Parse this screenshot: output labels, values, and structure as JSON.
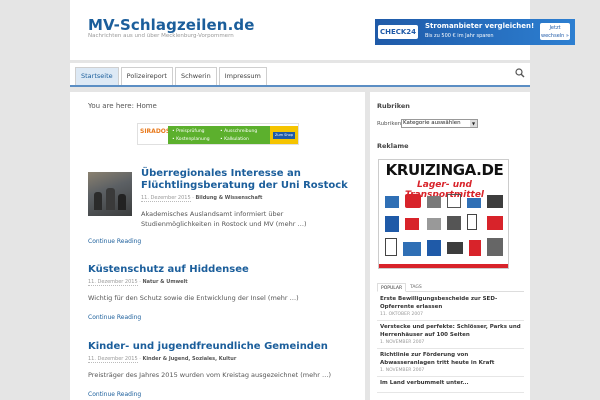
{
  "site": {
    "title": "MV-Schlagzeilen.de",
    "description": "Nachrichten aus und über Mecklenburg-Vorpommern"
  },
  "header_ad": {
    "brand": "CHECK24",
    "headline": "Stromanbieter vergleichen!",
    "subline": "Bis zu 500 € im Jahr sparen",
    "button": "Jetzt wechseln »"
  },
  "nav": {
    "items": [
      {
        "label": "Startseite",
        "active": true
      },
      {
        "label": "Polizeireport",
        "active": false
      },
      {
        "label": "Schwerin",
        "active": false
      },
      {
        "label": "Impressum",
        "active": false
      }
    ],
    "search_icon": "search-icon"
  },
  "main": {
    "breadcrumb": "You are here: Home",
    "mid_ad": {
      "brand": "SIRADOS",
      "features": [
        "• Preisprüfung",
        "• Ausschreibung",
        "• Kostenplanung",
        "• Kalkulation"
      ],
      "button": "Zum Shop"
    },
    "posts": [
      {
        "title": "Überregionales Interesse an Flüchtlingsberatung der Uni Rostock",
        "date": "11. Dezember 2015",
        "categories": "Bildung & Wissenschaft",
        "excerpt": "Akademisches Auslandsamt informiert über Studienmöglichkeiten in Rostock und MV (mehr …)",
        "continue": "Continue Reading"
      },
      {
        "title": "Küstenschutz auf Hiddensee",
        "date": "11. Dezember 2015",
        "categories": "Natur & Umwelt",
        "excerpt": "Wichtig für den Schutz sowie die Entwicklung der Insel (mehr …)",
        "continue": "Continue Reading"
      },
      {
        "title": "Kinder- und jugendfreundliche Gemeinden",
        "date": "11. Dezember 2015",
        "categories": "Kinder & Jugend, Soziales, Kultur",
        "excerpt": "Preisträger des Jahres 2015 wurden vom Kreistag ausgezeichnet (mehr …)",
        "continue": "Continue Reading"
      }
    ]
  },
  "sidebar": {
    "rubriken_title": "Rubriken",
    "rubriken_label": "Rubriken",
    "rubriken_select": "Kategorie auswählen",
    "reklame_title": "Reklame",
    "ad": {
      "title": "KRUIZINGA.DE",
      "subtitle": "Lager- und Transportmittel"
    },
    "tabs": [
      {
        "label": "POPULAR",
        "active": true
      },
      {
        "label": "TAGS",
        "active": false
      }
    ],
    "popular": [
      {
        "title": "Erste Bewilligungsbescheide zur SED-Opferrente erlassen",
        "date": "11. OKTOBER 2007"
      },
      {
        "title": "Verstecke und perfekte: Schlösser, Parks und Herrenhäuser auf 100 Seiten",
        "date": "1. NOVEMBER 2007"
      },
      {
        "title": "Richtlinie zur Förderung von Abwasseranlagen tritt heute in Kraft",
        "date": "1. NOVEMBER 2007"
      },
      {
        "title": "Im Land verbummelt unter...",
        "date": ""
      }
    ]
  },
  "colors": {
    "accent": "#1b5e9b",
    "nav_border": "#5b8ec4",
    "background": "#e5e5e5"
  }
}
